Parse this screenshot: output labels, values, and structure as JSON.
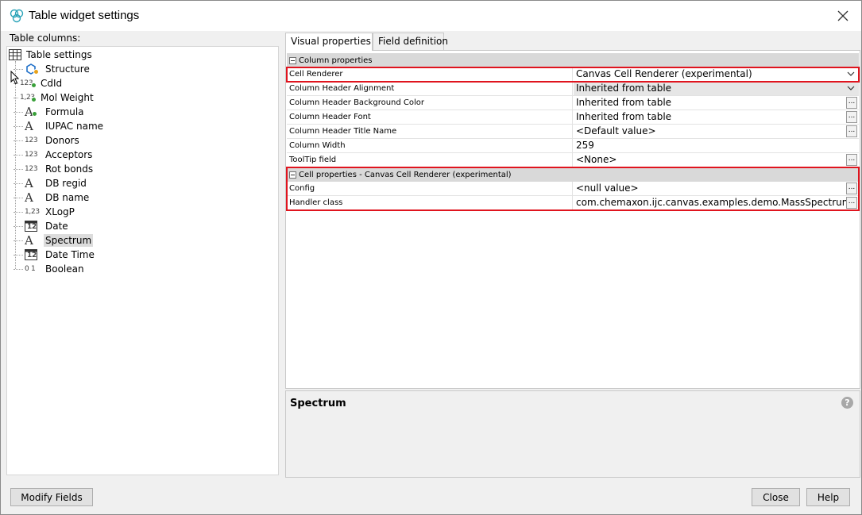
{
  "window": {
    "title": "Table widget settings",
    "app_icon": "chemaxon-logo-icon",
    "close_icon": "close-icon"
  },
  "left_panel": {
    "label": "Table columns:",
    "root": {
      "label": "Table settings",
      "icon": "table-grid-icon"
    },
    "items": [
      {
        "label": "Structure",
        "icon": "structure-icon"
      },
      {
        "label": "CdId",
        "icon": "integer-key-icon"
      },
      {
        "label": "Mol Weight",
        "icon": "decimal-calc-icon"
      },
      {
        "label": "Formula",
        "icon": "text-calc-icon"
      },
      {
        "label": "IUPAC name",
        "icon": "text-icon"
      },
      {
        "label": "Donors",
        "icon": "integer-icon"
      },
      {
        "label": "Acceptors",
        "icon": "integer-icon"
      },
      {
        "label": "Rot bonds",
        "icon": "integer-icon"
      },
      {
        "label": "DB regid",
        "icon": "text-icon"
      },
      {
        "label": "DB name",
        "icon": "text-icon"
      },
      {
        "label": "XLogP",
        "icon": "decimal-icon"
      },
      {
        "label": "Date",
        "icon": "calendar-icon"
      },
      {
        "label": "Spectrum",
        "icon": "text-icon",
        "selected": true
      },
      {
        "label": "Date Time",
        "icon": "calendar-icon"
      },
      {
        "label": "Boolean",
        "icon": "boolean-icon"
      }
    ],
    "icon_glyphs": {
      "integer": "123",
      "decimal": "1,23",
      "boolean": "0 1",
      "calendar": "12",
      "text": "A"
    }
  },
  "tabs": [
    {
      "label": "Visual properties",
      "active": true
    },
    {
      "label": "Field definition",
      "active": false
    }
  ],
  "column_properties": {
    "header": "Column properties",
    "rows": [
      {
        "name": "Cell Renderer",
        "value": "Canvas Cell Renderer (experimental)",
        "control": "dropdown"
      },
      {
        "name": "Column Header Alignment",
        "value": "Inherited from table",
        "control": "dropdown"
      },
      {
        "name": "Column Header Background Color",
        "value": "Inherited from table",
        "control": "ellipsis"
      },
      {
        "name": "Column Header Font",
        "value": "Inherited from table",
        "control": "ellipsis"
      },
      {
        "name": "Column Header Title Name",
        "value": "<Default value>",
        "control": "ellipsis"
      },
      {
        "name": "Column Width",
        "value": "259",
        "control": "none"
      },
      {
        "name": "ToolTip field",
        "value": "<None>",
        "control": "ellipsis"
      }
    ]
  },
  "cell_properties": {
    "header": "Cell properties - Canvas Cell Renderer (experimental)",
    "rows": [
      {
        "name": "Config",
        "value": "<null value>",
        "control": "ellipsis"
      },
      {
        "name": "Handler class",
        "value": "com.chemaxon.ijc.canvas.examples.demo.MassSpectrum...",
        "control": "ellipsis"
      }
    ]
  },
  "ellipsis_label": "...",
  "description": {
    "title": "Spectrum",
    "help_label": "?"
  },
  "buttons": {
    "modify_fields": "Modify Fields",
    "close": "Close",
    "help": "Help"
  },
  "colors": {
    "highlight_border": "#e0141e",
    "section_header_bg": "#d9d9d9",
    "selected_bg": "#dcdcdc"
  }
}
